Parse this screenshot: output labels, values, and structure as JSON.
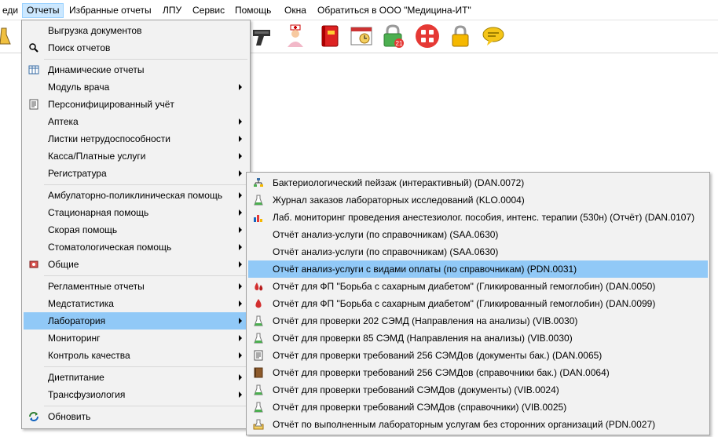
{
  "menubar": {
    "items": [
      "еди",
      "Отчеты",
      "Избранные отчеты",
      "ЛПУ",
      "Сервис",
      "Помощь",
      "Окна",
      "Обратиться в ООО \"Медицина-ИТ\""
    ]
  },
  "toolbar": {
    "badge": "21",
    "icons": [
      "flask-icon",
      "barcode-scanner-icon",
      "nurse-icon",
      "red-book-icon",
      "calendar-window-icon",
      "lock-badge-icon",
      "apps-icon",
      "padlock-icon",
      "message-icon"
    ]
  },
  "reports_menu": {
    "items": [
      "Выгрузка документов",
      "Поиск отчетов",
      "Динамические отчеты",
      "Модуль врача",
      "Персонифицированный учёт",
      "Аптека",
      "Листки нетрудоспособности",
      "Касса/Платные услуги",
      "Регистратура",
      "Амбулаторно-поликлиническая помощь",
      "Стационарная помощь",
      "Скорая помощь",
      "Стоматологическая помощь",
      "Общие",
      "Регламентные отчеты",
      "Медстатистика",
      "Лаборатория",
      "Мониторинг",
      "Контроль качества",
      "Диетпитание",
      "Трансфузиология",
      "Обновить"
    ]
  },
  "lab_menu": {
    "items": [
      "Бактериологический пейзаж (интерактивный) (DAN.0072)",
      "Журнал заказов лабораторных исследований (KLO.0004)",
      "Лаб. мониторинг проведения анестезиолог. пособия, интенс. терапии (530н) (Отчёт) (DAN.0107)",
      "Отчёт анализ-услуги (по справочникам) (SAA.0630)",
      "Отчёт анализ-услуги (по справочникам) (SAA.0630)",
      "Отчёт анализ-услуги с видами оплаты (по справочникам) (PDN.0031)",
      "Отчёт для ФП \"Борьба с сахарным диабетом\" (Гликированный гемоглобин) (DAN.0050)",
      "Отчёт для ФП \"Борьба с сахарным диабетом\" (Гликированный гемоглобин) (DAN.0099)",
      "Отчёт для проверки 202 СЭМД (Направления на анализы) (VIB.0030)",
      "Отчёт для проверки 85 СЭМД (Направления на анализы) (VIB.0030)",
      "Отчёт для проверки требований 256 СЭМДов (документы бак.) (DAN.0065)",
      "Отчёт для проверки требований 256 СЭМДов (справочники бак.) (DAN.0064)",
      "Отчёт для проверки требований СЭМДов (документы) (VIB.0024)",
      "Отчёт для проверки требований СЭМДов (справочники) (VIB.0025)",
      "Отчёт по выполненным лабораторным услугам без сторонних организаций (PDN.0027)"
    ]
  },
  "colors": {
    "highlight": "#91c9f7",
    "active_menu": "#cce8ff",
    "menu_bg": "#f2f2f2"
  }
}
